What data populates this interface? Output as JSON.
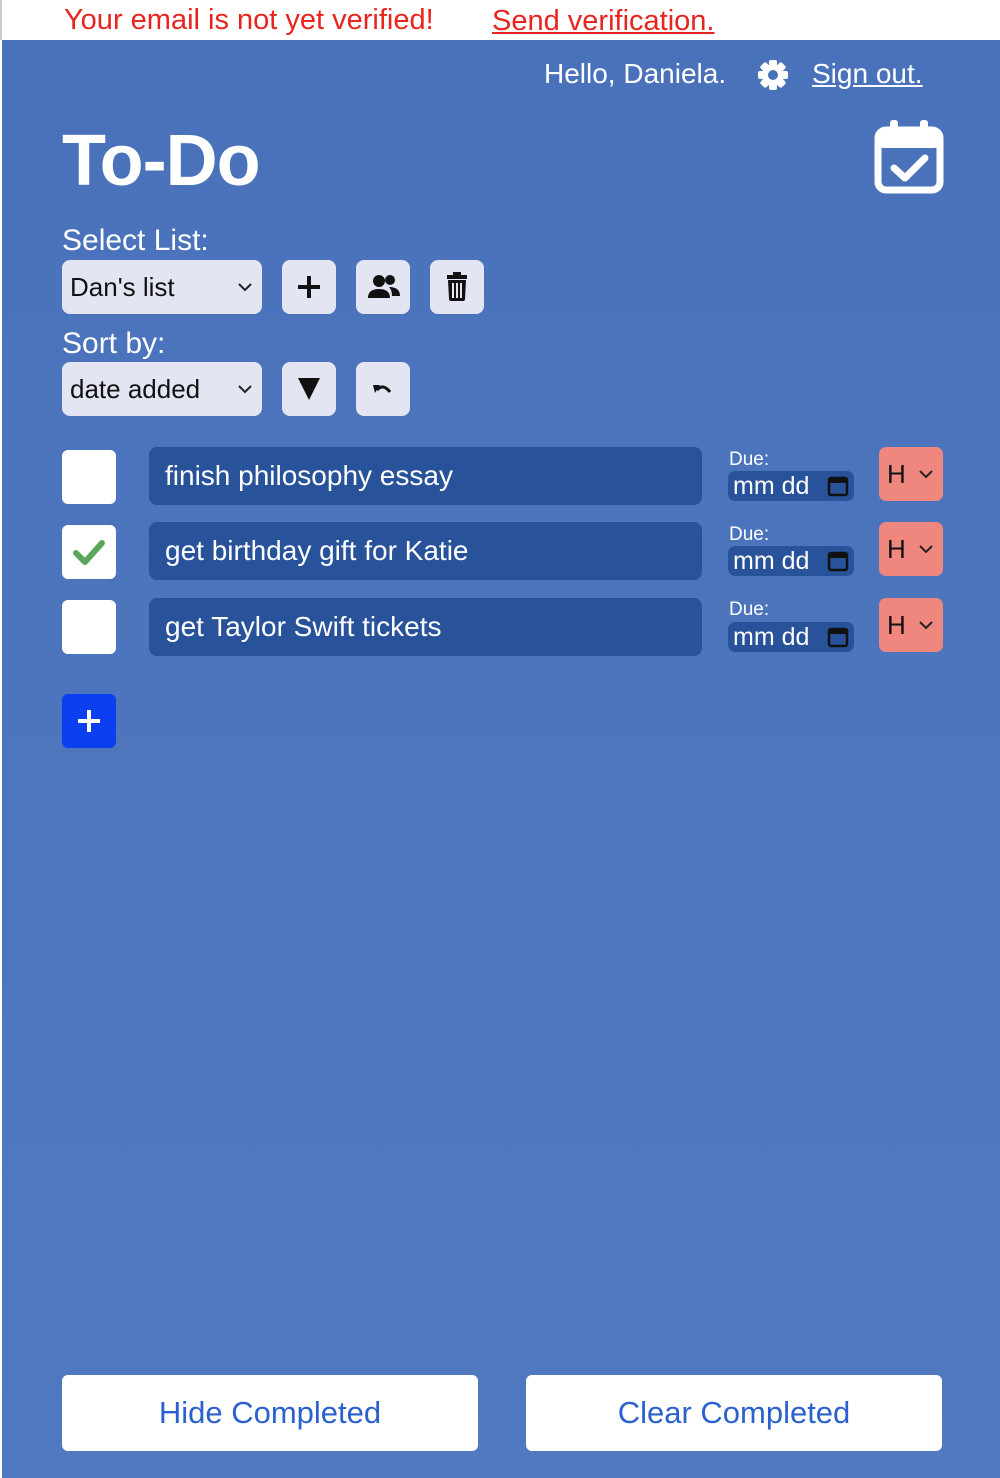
{
  "banner": {
    "message": "Your email is not yet verified!",
    "link_label": "Send verification."
  },
  "header": {
    "greeting": "Hello, Daniela.",
    "settings_icon": "gear-icon",
    "signout_label": "Sign out.",
    "title": "To-Do",
    "calendar_icon": "calendar-check-icon"
  },
  "list_select": {
    "label": "Select List:",
    "value": "Dan's list",
    "add_icon": "plus-icon",
    "share_icon": "users-icon",
    "delete_icon": "trash-icon"
  },
  "sort": {
    "label": "Sort by:",
    "value": "date added",
    "direction_icon": "triangle-down-icon",
    "undo_icon": "undo-icon"
  },
  "tasks": [
    {
      "text": "finish philosophy essay",
      "completed": false,
      "due_label": "Due:",
      "due_placeholder": "mm dd",
      "priority": "H"
    },
    {
      "text": "get birthday gift for Katie",
      "completed": true,
      "due_label": "Due:",
      "due_placeholder": "mm dd",
      "priority": "H"
    },
    {
      "text": "get Taylor Swift tickets",
      "completed": false,
      "due_label": "Due:",
      "due_placeholder": "mm dd",
      "priority": "H"
    }
  ],
  "add_task_icon": "plus-icon",
  "footer": {
    "hide_label": "Hide Completed",
    "clear_label": "Clear Completed"
  },
  "colors": {
    "app_background": "#4a72bb",
    "task_background": "#28529a",
    "priority_high": "#f0877f",
    "warning": "#e8241f",
    "add_button": "#0b3ff0",
    "check": "#5aa65a",
    "footer_text": "#2a61cf"
  }
}
